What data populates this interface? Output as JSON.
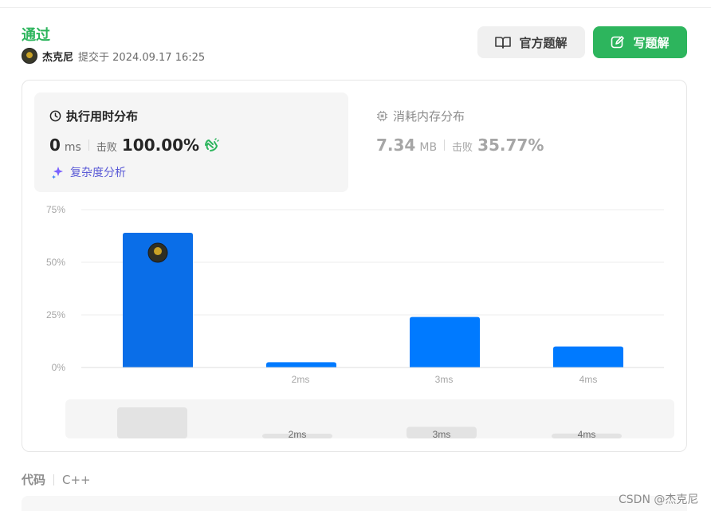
{
  "header": {
    "status": "通过",
    "username": "杰克尼",
    "submit_text": "提交于 2024.09.17 16:25"
  },
  "buttons": {
    "official_solution": "官方题解",
    "write_solution": "写题解"
  },
  "runtime": {
    "title": "执行用时分布",
    "value": "0",
    "unit": "ms",
    "beat_label": "击败",
    "beat_value": "100.00%"
  },
  "memory": {
    "title": "消耗内存分布",
    "value": "7.34",
    "unit": "MB",
    "beat_label": "击败",
    "beat_value": "35.77%"
  },
  "complexity_link": "复杂度分析",
  "code": {
    "label": "代码",
    "language": "C++"
  },
  "watermark": "CSDN @杰克尼",
  "colors": {
    "accent_green": "#2db55d",
    "bar_blue": "#007aff",
    "bar_selected": "#0a6ee8",
    "complexity_purple": "#5a5ad6"
  },
  "chart_data": {
    "type": "bar",
    "categories": [
      "",
      "2ms",
      "3ms",
      "4ms"
    ],
    "values": [
      64,
      2.5,
      24,
      10
    ],
    "highlight_index": 0,
    "ylim": [
      0,
      75
    ],
    "yticks": [
      0,
      25,
      50,
      75
    ],
    "ytick_labels": [
      "0%",
      "25%",
      "50%",
      "75%"
    ],
    "grid": true,
    "mini_labels": [
      "",
      "2ms",
      "3ms",
      "4ms"
    ]
  }
}
